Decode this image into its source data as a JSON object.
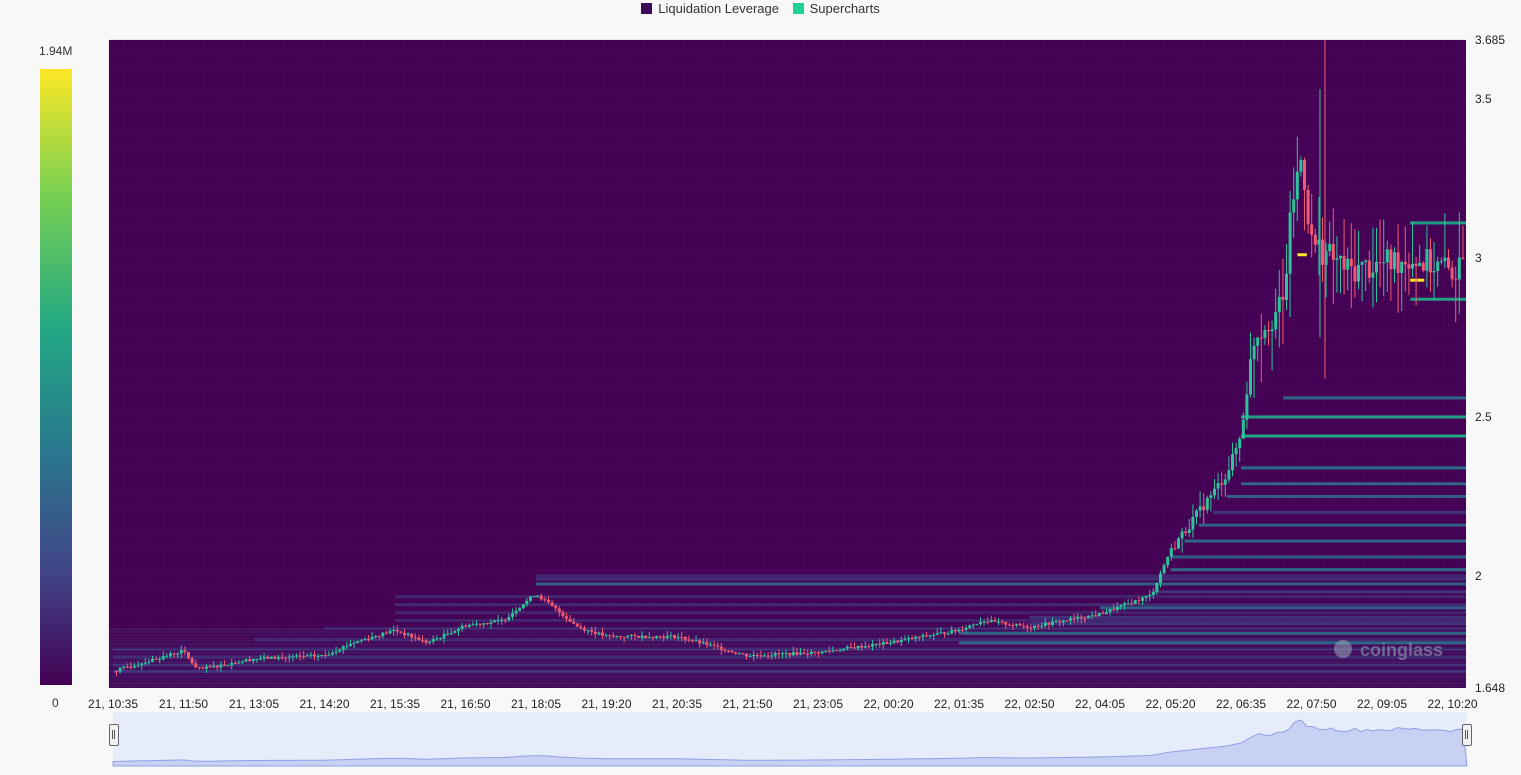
{
  "legend": {
    "items": [
      {
        "label": "Liquidation Leverage",
        "color": "#3d0a5b"
      },
      {
        "label": "Supercharts",
        "color": "#1ed494"
      }
    ]
  },
  "colorbar": {
    "max_label": "1.94M",
    "min_label": "0"
  },
  "watermark": "coinglass",
  "colors": {
    "background": "#440154",
    "up_candle": "#2ec39a",
    "down_candle": "#ef5a73",
    "heatmap_low": "#414487",
    "heatmap_mid": "#2a788e",
    "heatmap_high": "#22a884",
    "heatmap_peak": "#fde725"
  },
  "chart_data": {
    "type": "heatmap",
    "title": "",
    "xlabel": "",
    "ylabel": "",
    "x_ticks": [
      "21, 10:35",
      "21, 11:50",
      "21, 13:05",
      "21, 14:20",
      "21, 15:35",
      "21, 16:50",
      "21, 18:05",
      "21, 19:20",
      "21, 20:35",
      "21, 21:50",
      "21, 23:05",
      "22, 00:20",
      "22, 01:35",
      "22, 02:50",
      "22, 04:05",
      "22, 05:20",
      "22, 06:35",
      "22, 07:50",
      "22, 09:05",
      "22, 10:20"
    ],
    "y_ticks": [
      "3.685",
      "3.5",
      "3",
      "2.5",
      "2",
      "1.648"
    ],
    "y_tick_values": [
      3.685,
      3.5,
      3.0,
      2.5,
      2.0,
      1.648
    ],
    "ylim": [
      1.648,
      3.685
    ],
    "color_scale": {
      "min": 0,
      "max": 1940000
    },
    "price_series": {
      "label": "Supercharts",
      "anchors": [
        [
          "21, 10:35",
          1.7
        ],
        [
          "21, 11:50",
          1.765
        ],
        [
          "21, 12:05",
          1.705
        ],
        [
          "21, 13:05",
          1.74
        ],
        [
          "21, 14:20",
          1.75
        ],
        [
          "21, 14:50",
          1.79
        ],
        [
          "21, 15:35",
          1.83
        ],
        [
          "21, 16:10",
          1.79
        ],
        [
          "21, 16:50",
          1.845
        ],
        [
          "21, 17:30",
          1.86
        ],
        [
          "21, 18:05",
          1.945
        ],
        [
          "21, 18:50",
          1.84
        ],
        [
          "21, 19:20",
          1.81
        ],
        [
          "21, 20:35",
          1.81
        ],
        [
          "21, 21:50",
          1.75
        ],
        [
          "21, 23:05",
          1.76
        ],
        [
          "22, 00:20",
          1.79
        ],
        [
          "22, 01:35",
          1.83
        ],
        [
          "22, 02:00",
          1.86
        ],
        [
          "22, 02:50",
          1.84
        ],
        [
          "22, 04:05",
          1.88
        ],
        [
          "22, 05:00",
          1.94
        ],
        [
          "22, 05:20",
          2.08
        ],
        [
          "22, 05:50",
          2.2
        ],
        [
          "22, 06:20",
          2.32
        ],
        [
          "22, 06:35",
          2.44
        ],
        [
          "22, 06:50",
          2.76
        ],
        [
          "22, 07:20",
          2.85
        ],
        [
          "22, 07:30",
          3.18
        ],
        [
          "22, 07:40",
          3.32
        ],
        [
          "22, 07:50",
          3.05
        ],
        [
          "22, 08:30",
          2.96
        ],
        [
          "22, 09:05",
          2.98
        ],
        [
          "22, 09:35",
          3.0
        ],
        [
          "22, 10:20",
          2.96
        ]
      ]
    },
    "liquidation_bands": [
      {
        "price": 1.7,
        "from": "21, 10:35",
        "intensity": 0.45
      },
      {
        "price": 1.72,
        "from": "21, 10:35",
        "intensity": 0.4
      },
      {
        "price": 1.745,
        "from": "21, 10:35",
        "intensity": 0.35
      },
      {
        "price": 1.77,
        "from": "21, 10:35",
        "intensity": 0.3
      },
      {
        "price": 1.8,
        "from": "21, 13:05",
        "intensity": 0.25
      },
      {
        "price": 1.835,
        "from": "21, 14:20",
        "intensity": 0.25
      },
      {
        "price": 1.86,
        "from": "21, 15:35",
        "intensity": 0.3
      },
      {
        "price": 1.885,
        "from": "21, 15:35",
        "intensity": 0.25
      },
      {
        "price": 1.91,
        "from": "21, 15:35",
        "intensity": 0.35
      },
      {
        "price": 1.935,
        "from": "21, 15:35",
        "intensity": 0.3
      },
      {
        "price": 1.975,
        "from": "21, 18:05",
        "intensity": 0.55
      },
      {
        "price": 1.99,
        "from": "21, 18:05",
        "intensity": 0.4
      },
      {
        "price": 2.0,
        "from": "21, 18:05",
        "intensity": 0.35
      },
      {
        "price": 1.79,
        "from": "22, 01:35",
        "intensity": 0.6
      },
      {
        "price": 1.82,
        "from": "22, 01:35",
        "intensity": 0.55
      },
      {
        "price": 1.85,
        "from": "22, 02:50",
        "intensity": 0.5
      },
      {
        "price": 1.87,
        "from": "22, 02:50",
        "intensity": 0.45
      },
      {
        "price": 1.9,
        "from": "22, 04:05",
        "intensity": 0.55
      },
      {
        "price": 1.95,
        "from": "22, 05:00",
        "intensity": 0.5
      },
      {
        "price": 2.02,
        "from": "22, 05:20",
        "intensity": 0.6
      },
      {
        "price": 2.06,
        "from": "22, 05:20",
        "intensity": 0.55
      },
      {
        "price": 2.11,
        "from": "22, 05:35",
        "intensity": 0.6
      },
      {
        "price": 2.16,
        "from": "22, 05:50",
        "intensity": 0.55
      },
      {
        "price": 2.2,
        "from": "22, 06:05",
        "intensity": 0.5
      },
      {
        "price": 2.25,
        "from": "22, 06:20",
        "intensity": 0.55
      },
      {
        "price": 2.29,
        "from": "22, 06:35",
        "intensity": 0.6
      },
      {
        "price": 2.34,
        "from": "22, 06:35",
        "intensity": 0.65
      },
      {
        "price": 2.44,
        "from": "22, 06:35",
        "intensity": 0.75
      },
      {
        "price": 2.5,
        "from": "22, 06:35",
        "intensity": 0.7
      },
      {
        "price": 2.56,
        "from": "22, 07:20",
        "intensity": 0.6
      },
      {
        "price": 2.87,
        "from": "22, 09:35",
        "intensity": 0.7
      },
      {
        "price": 3.11,
        "from": "22, 09:35",
        "intensity": 0.7
      }
    ],
    "hotspots": [
      {
        "price": 3.01,
        "from": "22, 07:35",
        "to": "22, 07:45",
        "intensity": 1.0
      },
      {
        "price": 2.93,
        "from": "22, 09:35",
        "to": "22, 09:50",
        "intensity": 1.0
      }
    ],
    "grid": false,
    "legend_position": "top"
  }
}
